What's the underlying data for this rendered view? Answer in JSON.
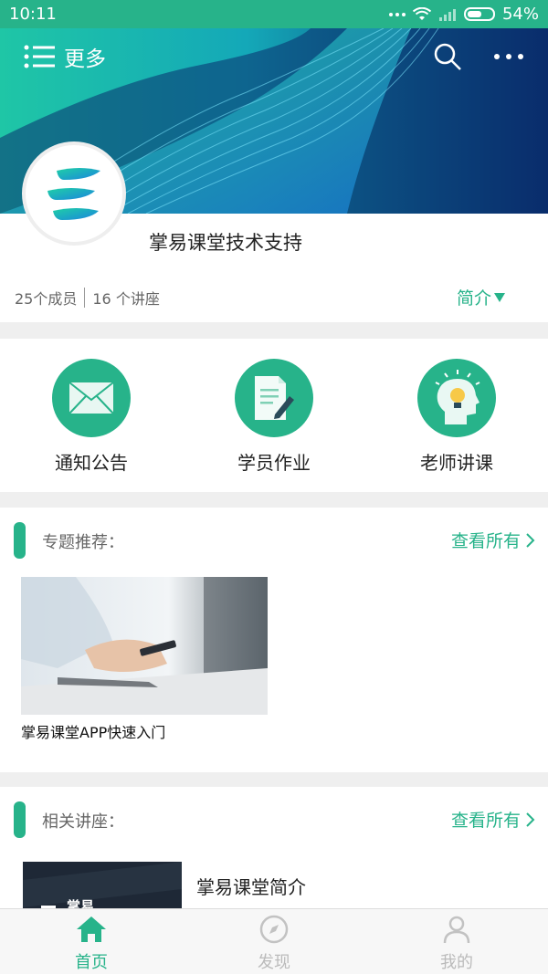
{
  "status": {
    "time": "10:11",
    "battery": "54%"
  },
  "header": {
    "menu_label": "更多"
  },
  "group": {
    "name": "掌易课堂技术支持",
    "members": "25个成员",
    "lectures": "16 个讲座",
    "intro_label": "简介"
  },
  "actions": [
    {
      "label": "通知公告",
      "icon": "mail-icon"
    },
    {
      "label": "学员作业",
      "icon": "homework-icon"
    },
    {
      "label": "老师讲课",
      "icon": "idea-icon"
    }
  ],
  "topics": {
    "title": "专题推荐：",
    "more": "查看所有",
    "items": [
      {
        "title": "掌易课堂APP快速入门"
      }
    ]
  },
  "lectures": {
    "title": "相关讲座：",
    "more": "查看所有",
    "items": [
      {
        "title": "掌易课堂简介",
        "thumb_text": "掌易"
      }
    ]
  },
  "nav": [
    {
      "label": "首页",
      "icon": "home-icon",
      "active": true
    },
    {
      "label": "发现",
      "icon": "compass-icon",
      "active": false
    },
    {
      "label": "我的",
      "icon": "user-icon",
      "active": false
    }
  ],
  "colors": {
    "accent": "#27b38a",
    "banner_dark": "#0b2c6b"
  }
}
